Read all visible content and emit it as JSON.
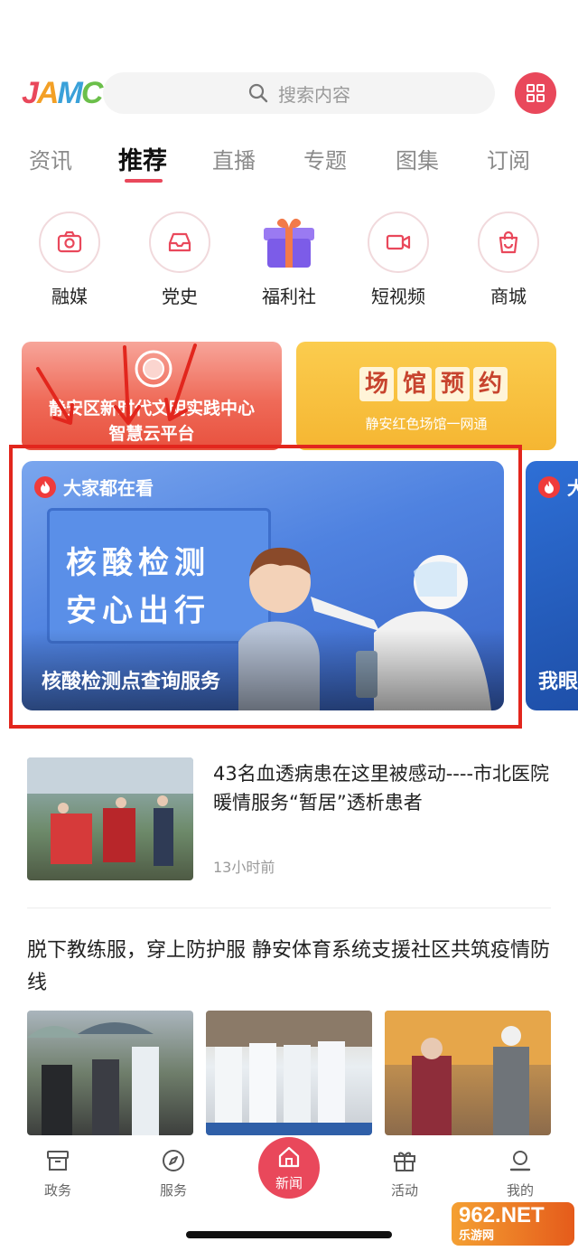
{
  "header": {
    "logo_text": "JAMC",
    "search_placeholder": "搜索内容"
  },
  "tabs": [
    {
      "label": "资讯",
      "active": false
    },
    {
      "label": "推荐",
      "active": true
    },
    {
      "label": "直播",
      "active": false
    },
    {
      "label": "专题",
      "active": false
    },
    {
      "label": "图集",
      "active": false
    },
    {
      "label": "订阅",
      "active": false
    }
  ],
  "quick_links": [
    {
      "label": "融媒",
      "icon": "camera-icon"
    },
    {
      "label": "党史",
      "icon": "inbox-icon"
    },
    {
      "label": "福利社",
      "icon": "gift-icon"
    },
    {
      "label": "短视频",
      "icon": "video-camera-icon"
    },
    {
      "label": "商城",
      "icon": "shopping-bag-icon"
    }
  ],
  "promos": {
    "left_line1": "静安区新时代文明实践中心",
    "left_line2": "智慧云平台",
    "right_title": [
      "场",
      "馆",
      "预",
      "约"
    ],
    "right_sub": "静安红色场馆一网通"
  },
  "carousel": {
    "badge": "大家都在看",
    "sign_line1": "核酸检测",
    "sign_line2": "安心出行",
    "caption": "核酸检测点查询服务",
    "next_badge": "大",
    "next_caption": "我眼"
  },
  "news": [
    {
      "title": "43名血透病患在这里被感动----市北医院暖情服务“暂居”透析患者",
      "time": "13小时前"
    },
    {
      "title": "脱下教练服，穿上防护服 静安体育系统支援社区共筑疫情防线"
    }
  ],
  "bottom_nav": [
    {
      "label": "政务",
      "icon": "archive-icon"
    },
    {
      "label": "服务",
      "icon": "compass-icon"
    },
    {
      "label": "新闻",
      "icon": "home-icon",
      "active": true
    },
    {
      "label": "活动",
      "icon": "gift-icon"
    },
    {
      "label": "我的",
      "icon": "user-icon"
    }
  ],
  "watermark": {
    "line1": "962.NET",
    "line2": "乐游网"
  },
  "colors": {
    "accent": "#e9485b",
    "highlight_box": "#e2261d"
  }
}
